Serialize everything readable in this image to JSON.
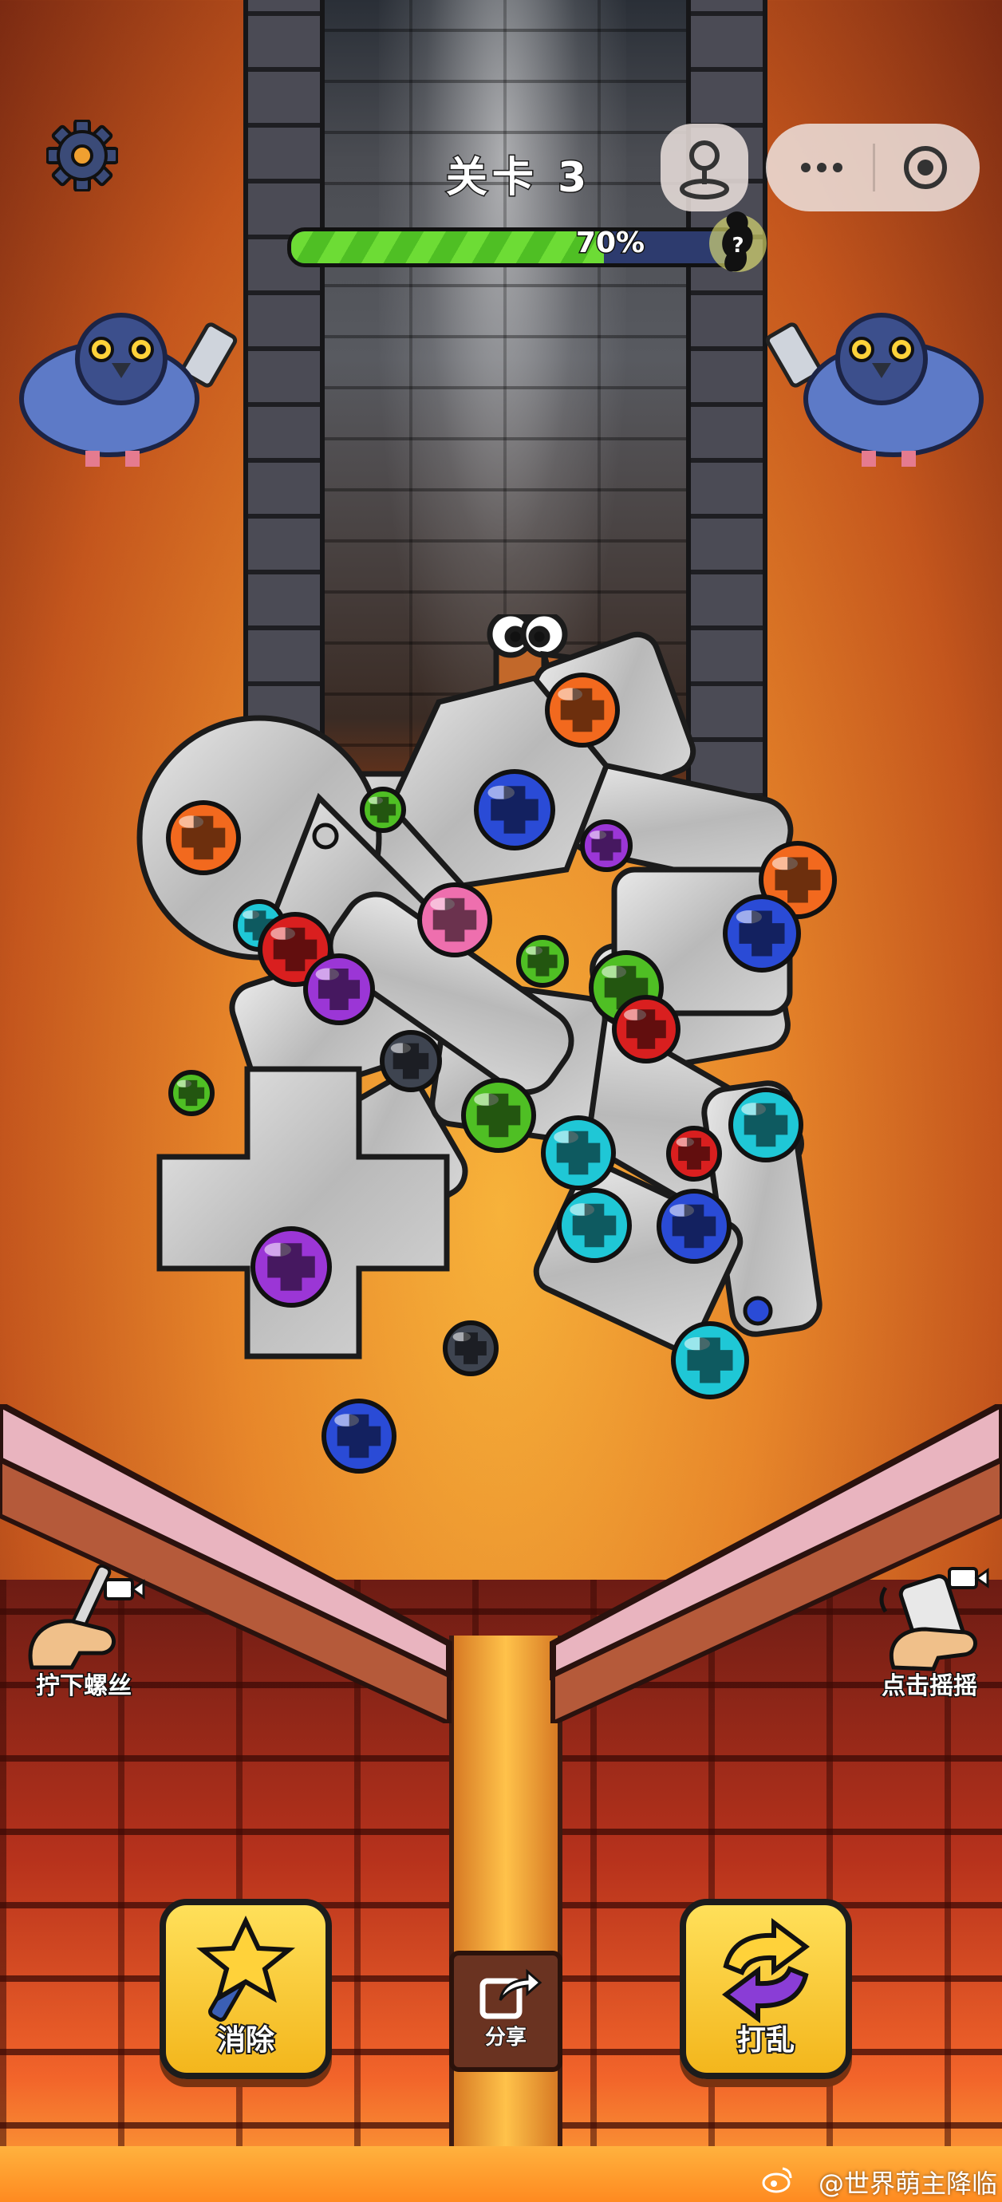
{
  "header": {
    "level_label": "关卡 3",
    "progress_percent": 70,
    "progress_text": "70%"
  },
  "miniprogram": {
    "more_icon": "more-dots-icon",
    "close_icon": "record-circle-icon",
    "joystick_icon": "joystick-icon"
  },
  "tools": {
    "unscrew_label": "拧下螺丝",
    "shake_label": "点击摇摇",
    "remove_label": "消除",
    "shuffle_label": "打乱",
    "share_label": "分享"
  },
  "watermark": {
    "text": "@世界萌主降临"
  },
  "colors": {
    "progress_fill": "#5bcb2a",
    "progress_track": "#2d3b6e",
    "button_yellow": "#f7c52a",
    "lava": "#ff9a2a"
  },
  "screws": [
    "orange",
    "blue",
    "purple",
    "red",
    "pink",
    "green",
    "cyan",
    "dark-gray"
  ]
}
